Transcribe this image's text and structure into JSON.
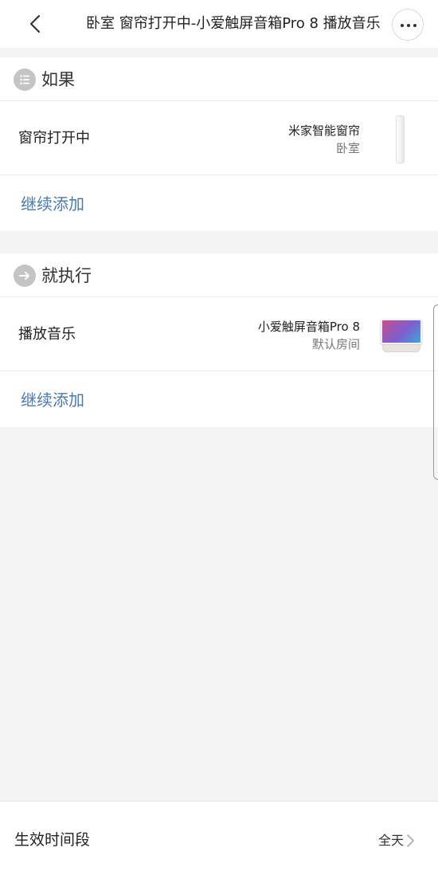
{
  "header": {
    "title": "卧室 窗帘打开中-小爱触屏音箱Pro 8 播放音乐",
    "back_icon": "chevron-left-icon",
    "more_icon": "more-dots-icon"
  },
  "if_section": {
    "title": "如果",
    "icon": "list-icon",
    "condition": {
      "label": "窗帘打开中",
      "device_name": "米家智能窗帘",
      "device_room": "卧室",
      "device_image": "curtain-image"
    },
    "add_label": "继续添加"
  },
  "then_section": {
    "title": "就执行",
    "icon": "arrow-right-icon",
    "action": {
      "label": "播放音乐",
      "device_name": "小爱触屏音箱Pro 8",
      "device_room": "默认房间",
      "device_image": "smart-speaker-image"
    },
    "add_label": "继续添加"
  },
  "footer": {
    "label": "生效时间段",
    "value": "全天",
    "chevron_icon": "chevron-right-icon"
  },
  "colors": {
    "accent_link": "#4a79b2",
    "background": "#f4f4f4",
    "section_icon": "#c4c4c4"
  }
}
